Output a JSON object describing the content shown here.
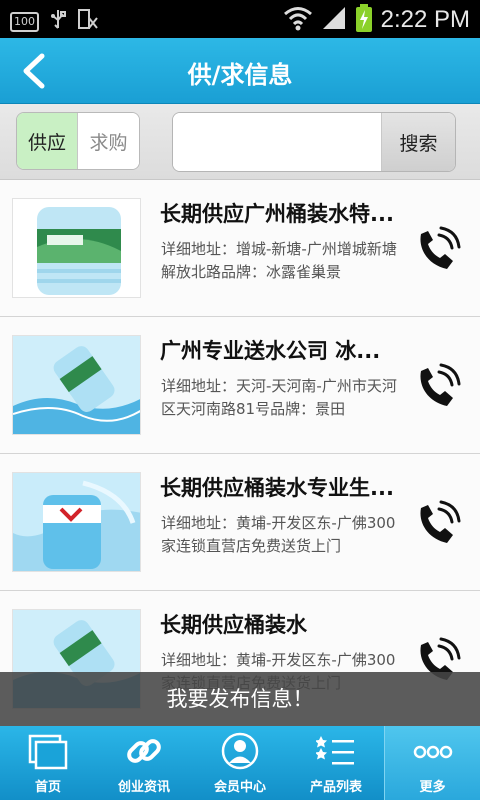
{
  "status_bar": {
    "battery_box": "100",
    "time": "2:22 PM",
    "icons": [
      "battery-level-icon",
      "usb-icon",
      "debug-icon",
      "wifi-icon",
      "signal-icon",
      "battery-charging-icon"
    ]
  },
  "header": {
    "title": "供/求信息",
    "back_icon": "chevron-left-icon"
  },
  "filter": {
    "tabs": [
      {
        "label": "供应",
        "selected": true
      },
      {
        "label": "求购",
        "selected": false
      }
    ],
    "search_placeholder": "",
    "search_button": "搜索"
  },
  "list": {
    "items": [
      {
        "title": "长期供应广州桶装水特...",
        "desc": "详细地址：增城-新塘-广州增城新塘解放北路品牌：冰露雀巢景",
        "image": "bottled-water-image",
        "action_icon": "phone-icon"
      },
      {
        "title": "广州专业送水公司 冰...",
        "desc": "详细地址：天河-天河南-广州市天河区天河南路81号品牌：景田",
        "image": "bottled-water-image",
        "action_icon": "phone-icon"
      },
      {
        "title": "长期供应桶装水专业生...",
        "desc": "详细地址：黄埔-开发区东-广佛300家连锁直营店免费送货上门",
        "image": "bottled-water-image",
        "action_icon": "phone-icon"
      },
      {
        "title": "长期供应桶装水",
        "desc": "详细地址：黄埔-开发区东-广佛300家连锁直营店免费送货上门",
        "image": "bottled-water-image",
        "action_icon": "phone-icon"
      }
    ]
  },
  "publish_banner": "我要发布信息！",
  "tabbar": {
    "items": [
      {
        "label": "首页",
        "icon": "windows-icon",
        "active": false
      },
      {
        "label": "创业资讯",
        "icon": "link-icon",
        "active": false
      },
      {
        "label": "会员中心",
        "icon": "user-icon",
        "active": false
      },
      {
        "label": "产品列表",
        "icon": "list-icon",
        "active": false
      },
      {
        "label": "更多",
        "icon": "more-icon",
        "active": true
      }
    ]
  },
  "colors": {
    "accent": "#1aa3d9",
    "selected_tab": "#c9f0c4",
    "banner": "#464646"
  }
}
